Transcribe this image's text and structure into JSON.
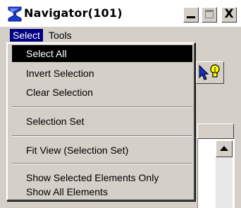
{
  "window": {
    "title": "Navigator(101)",
    "close_glyph": "X"
  },
  "menubar": {
    "items": [
      {
        "label": "Select"
      },
      {
        "label": "Tools"
      }
    ]
  },
  "dropdown": {
    "items": [
      {
        "label": "Select All",
        "selected": true
      },
      {
        "label": "Invert Selection"
      },
      {
        "label": "Clear Selection"
      },
      {
        "label": "Selection Set"
      },
      {
        "label": "Fit View (Selection Set)"
      },
      {
        "label": "Show Selected Elements Only"
      },
      {
        "label": "Show All Elements"
      }
    ]
  },
  "icons": {
    "app": "navigator-app-icon",
    "toolbar": "select-arrow-bulb-icon",
    "scroll_up": "scroll-up-arrow-icon"
  },
  "colors": {
    "menu_highlight": "#000080",
    "item_selected": "#000000",
    "window_bg": "#d4d0c8"
  }
}
